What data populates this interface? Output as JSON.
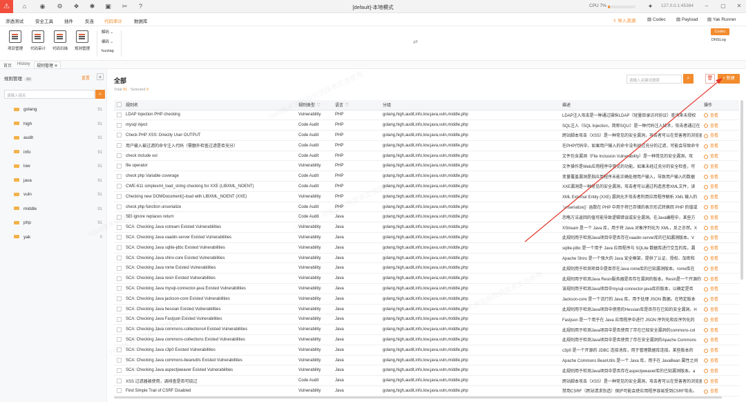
{
  "titlebar": {
    "title": "[default]-本地模式",
    "cpu_label": "CPU",
    "cpu_value": "7%",
    "cpu_fraction": 0.07,
    "address": "127.0.0.1:45384"
  },
  "menu": {
    "items": [
      "渗透测试",
      "安全工具",
      "插件",
      "反连",
      "代码审计",
      "数据库"
    ],
    "active_index": 4,
    "import_label": "导入资源",
    "codec_label": "Codec",
    "payload_label": "Payload",
    "runner_label": "Yak Runner"
  },
  "toolbar": {
    "tools": [
      "项目管理",
      "代码审计",
      "代码扫描",
      "规则管理"
    ],
    "decode_label": "解码",
    "encode_label": "编码",
    "fuzztag_label": "fuzztag",
    "right_codec": "Codec",
    "right_dnslog": "DNSLog"
  },
  "page_tabs": [
    "首页",
    "History",
    "规则管理"
  ],
  "sidebar": {
    "title": "规则管理",
    "count": "10",
    "reset_label": "重置",
    "search_placeholder": "请输入组名",
    "groups": [
      {
        "name": "golang",
        "count": "91"
      },
      {
        "name": "high",
        "count": "91"
      },
      {
        "name": "audit",
        "count": "91"
      },
      {
        "name": "info",
        "count": "91"
      },
      {
        "name": "low",
        "count": "91"
      },
      {
        "name": "java",
        "count": "91"
      },
      {
        "name": "vuln",
        "count": "91"
      },
      {
        "name": "middle",
        "count": "91"
      },
      {
        "name": "php",
        "count": "91"
      },
      {
        "name": "yak",
        "count": "0"
      }
    ]
  },
  "main": {
    "title": "全部",
    "total_label": "Total",
    "total_value": "91",
    "selected_label": "Selected",
    "selected_value": "0",
    "search_placeholder": "请输入关键词搜索",
    "add_label": "新建",
    "columns": [
      "规则名",
      "规则类型",
      "语言",
      "分组",
      "描述",
      "操作"
    ],
    "view_label": "查看",
    "rows": [
      {
        "name": "LDAP Injection PHP checking",
        "type": "Vulnerability",
        "lang": "PHP",
        "group": "golang,high,audit,info,low,java,vuln,middle,php",
        "desc": "LDAP注入攻击是一种通过操纵LDAP（轻量目录访问协议）查询来未授权"
      },
      {
        "name": "mysql inject",
        "type": "Code Audit",
        "lang": "PHP",
        "group": "golang,high,audit,info,low,java,vuln,middle,php",
        "desc": "SQL注入（SQL Injection，简称SQLI）是一种代码注入技术，攻击者通过在"
      },
      {
        "name": "Check PHP XSS: Directly User OUTPUT",
        "type": "Code Audit",
        "lang": "PHP",
        "group": "golang,high,audit,info,low,java,vuln,middle,php",
        "desc": "跨站脚本攻击（XSS）是一种常见的安全漏洞，攻击者可以在受害者的浏览器"
      },
      {
        "name": "用户输入被过滤的命令注入代码（需额外检查过滤是否充分）",
        "type": "Code Audit",
        "lang": "PHP",
        "group": "golang,high,audit,info,low,java,vuln,middle,php",
        "desc": "在PHP代码中，如果用户输入的命令没有经过充分的过滤，可能会导致命令"
      },
      {
        "name": "check include vul",
        "type": "Code Audit",
        "lang": "PHP",
        "group": "golang,high,audit,info,low,java,vuln,middle,php",
        "desc": "文件包含漏洞（File Inclusion Vulnerability）是一种常见的安全漏洞，攻"
      },
      {
        "name": "file operator",
        "type": "Vulnerability",
        "lang": "PHP",
        "group": "golang,high,audit,info,low,java,vuln,middle,php",
        "desc": "文件操作是Web应用程序中常见的功能。如果未经过充分的安全检查，可"
      },
      {
        "name": "check php Variable coverage",
        "type": "Code Audit",
        "lang": "PHP",
        "group": "golang,high,audit,info,low,java,vuln,middle,php",
        "desc": "变量覆盖漏洞是指应用程序未能正确处理用户输入，导致用户输入的数据"
      },
      {
        "name": "CWE-611 simplexml_load_string checking for XXE (LIBXML_NOENT)",
        "type": "Code Audit",
        "lang": "PHP",
        "group": "golang,high,audit,info,low,java,vuln,middle,php",
        "desc": "XXE漏洞是一种常见的安全漏洞，攻击者可以通过构造恶意XML文件，读"
      },
      {
        "name": "Checking new DOMDocument()-load with LIBXML_NOENT (XXE)",
        "type": "Vulnerability",
        "lang": "PHP",
        "group": "golang,high,audit,info,low,java,vuln,middle,php",
        "desc": "XML External Entity (XXE) 漏洞允许攻击者利用应用程序解析 XML 输入的"
      },
      {
        "name": "check php function unserialize",
        "type": "Code Audit",
        "lang": "PHP",
        "group": "golang,high,audit,info,low,java,vuln,middle,php",
        "desc": "`unserialize()` 函数在 PHP 中用于将已存储的表示形式转换回 PHP 的值或"
      },
      {
        "name": "SEI ignore replaces return",
        "type": "Code Audit",
        "lang": "Java",
        "group": "golang,high,audit,info,low,java,vuln,middle,php",
        "desc": "忽略方法返回的值可能导致逻辑错误或安全漏洞。在Java编程中，某些方"
      },
      {
        "name": "SCA: Checking Java xstream Existed Vulnerabilities",
        "type": "Vulnerability",
        "lang": "Java",
        "group": "golang,high,audit,info,low,java,vuln,middle,php",
        "desc": "XStream 是一个 Java 库，用于将 Java 对象序列化为 XML，反之亦然。X"
      },
      {
        "name": "SCA: Checking Java vaadin-server Existed Vulnerabilities",
        "type": "Vulnerability",
        "lang": "Java",
        "group": "golang,high,audit,info,low,java,vuln,middle,php",
        "desc": "此规则用于检测Java项目中是否存在vaadin-server库的已知漏洞版本。V"
      },
      {
        "name": "SCA: Checking Java sqlite-jdbc Existed Vulnerabilities",
        "type": "Vulnerability",
        "lang": "Java",
        "group": "golang,high,audit,info,low,java,vuln,middle,php",
        "desc": "sqlite-jdbc 是一个用于 Java 应用程序与 SQLite 数据库进行交互的库。漏"
      },
      {
        "name": "SCA: Checking Java shiro-core Existed Vulnerabilities",
        "type": "Vulnerability",
        "lang": "Java",
        "group": "golang,high,audit,info,low,java,vuln,middle,php",
        "desc": "Apache Shiro 是一个强大的 Java 安全框架，提供了认证、授权、加密和"
      },
      {
        "name": "SCA: Checking Java rome Existed Vulnerabilities",
        "type": "Vulnerability",
        "lang": "Java",
        "group": "golang,high,audit,info,low,java,vuln,middle,php",
        "desc": "此规则用于检测项目中是否存在Java rome库的已知漏洞版本。rome库在"
      },
      {
        "name": "SCA: Checking Java resin Existed Vulnerabilities",
        "type": "Vulnerability",
        "lang": "Java",
        "group": "golang,high,audit,info,low,java,vuln,middle,php",
        "desc": "此规则用于检测Java Resin服务器是否存在漏洞的版本。Resin是一个开源的"
      },
      {
        "name": "SCA: Checking Java mysql-connector-java Existed Vulnerabilities",
        "type": "Vulnerability",
        "lang": "Java",
        "group": "golang,high,audit,info,low,java,vuln,middle,php",
        "desc": "该规则用于检测Java项目中mysql-connector-java库的版本，以确定是否"
      },
      {
        "name": "SCA: Checking Java jackson-core Existed Vulnerabilities",
        "type": "Vulnerability",
        "lang": "Java",
        "group": "golang,high,audit,info,low,java,vuln,middle,php",
        "desc": "Jackson-core 是一个流行的 Java 库，用于处理 JSON 数据。在特定版本"
      },
      {
        "name": "SCA: Checking Java hessian Existed Vulnerabilities",
        "type": "Vulnerability",
        "lang": "Java",
        "group": "golang,high,audit,info,low,java,vuln,middle,php",
        "desc": "此规则用于检测Java项目中使用的Hessian库是否存在已知的安全漏洞。H"
      },
      {
        "name": "SCA: Checking Java Fastjson Existed Vulnerabilities",
        "type": "Vulnerability",
        "lang": "Java",
        "group": "golang,high,audit,info,low,java,vuln,middle,php",
        "desc": "Fastjson 是一个用于在 Java 应用程序中进行 JSON 序列化和反序列化的"
      },
      {
        "name": "SCA: Checking Java commons-collections4 Existed Vulnerabilities",
        "type": "Vulnerability",
        "lang": "Java",
        "group": "golang,high,audit,info,low,java,vuln,middle,php",
        "desc": "此规则用于检测Java项目中是否使用了存在已知安全漏洞的commons-col"
      },
      {
        "name": "SCA: Checking Java commons-collections Existed Vulnerabilities",
        "type": "Vulnerability",
        "lang": "Java",
        "group": "golang,high,audit,info,low,java,vuln,middle,php",
        "desc": "此规则用于检测Java项目中是否使用了存在安全漏洞的Apache Commons"
      },
      {
        "name": "SCA: Checking Java c3p0 Existed Vulnerabilities",
        "type": "Vulnerability",
        "lang": "Java",
        "group": "golang,high,audit,info,low,java,vuln,middle,php",
        "desc": "c3p0 是一个开源的 JDBC 连接池库，用于管理数据库连接。某些版本的"
      },
      {
        "name": "SCA: Checking Java commons-beanutils Existed Vulnerabilities",
        "type": "Vulnerability",
        "lang": "Java",
        "group": "golang,high,audit,info,low,java,vuln,middle,php",
        "desc": "Apache Commons BeanUtils 是一个 Java 库，用于在 JavaBean 属性之间"
      },
      {
        "name": "SCA: Checking Java aspectjweaver Existed Vulnerabilities",
        "type": "Vulnerability",
        "lang": "Java",
        "group": "golang,high,audit,info,low,java,vuln,middle,php",
        "desc": "此规则用于检测Java项目中是否存在aspectjweaver库的已知漏洞版本。a"
      },
      {
        "name": "XSS 过滤器被使用，调排查是否可绕过",
        "type": "Code Audit",
        "lang": "Java",
        "group": "golang,high,audit,info,low,java,vuln,middle,php",
        "desc": "跨站脚本攻击（XSS）是一种常见的安全漏洞，攻击者可以在受害者的浏览器"
      },
      {
        "name": "Find Simple Trail of CSRF Disabled",
        "type": "Vulnerability",
        "lang": "Java",
        "group": "golang,high,audit,info,low,java,vuln,middle,php",
        "desc": "禁用CSRF（跨站请求伪造）保护可能会使应用程序容易受到CSRF攻击。"
      }
    ]
  },
  "colors": {
    "accent": "#f28b2c",
    "logo": "#f24e3d",
    "arrow": "#e2362a"
  },
  "watermark": "Yakit技术浏览版仅供技术交流使用"
}
